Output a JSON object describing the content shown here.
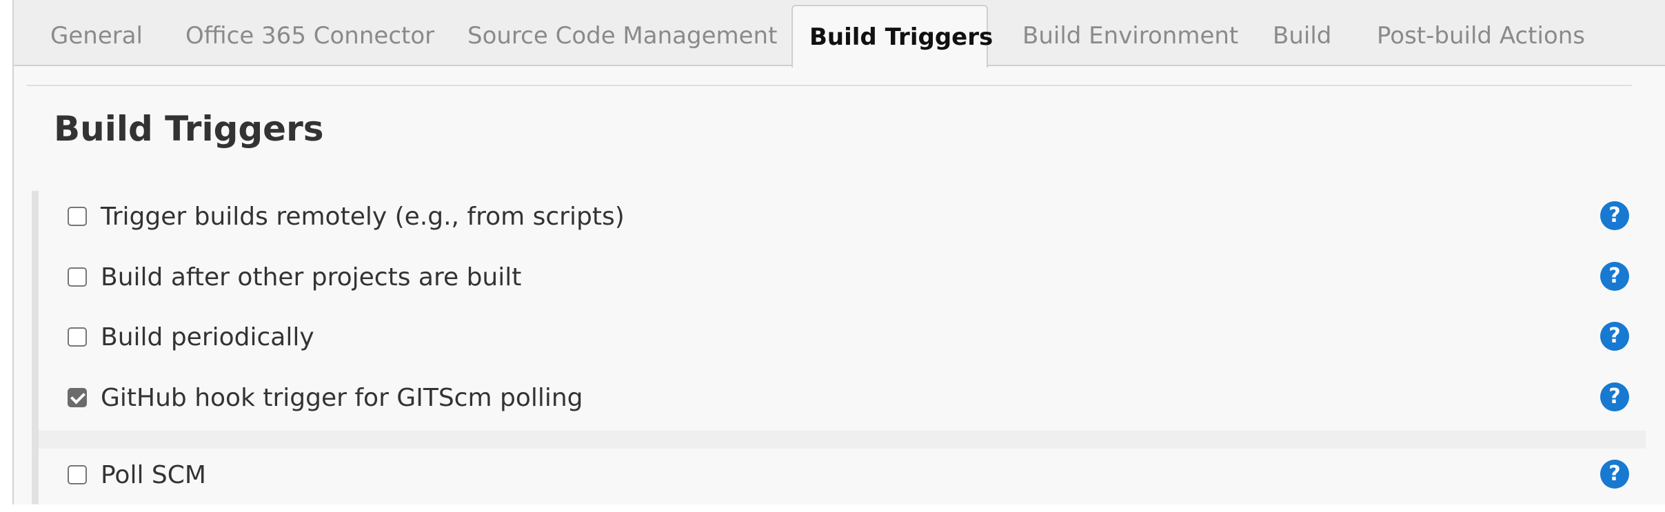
{
  "tabs": [
    {
      "label": "General"
    },
    {
      "label": "Office 365 Connector"
    },
    {
      "label": "Source Code Management"
    },
    {
      "label": "Build Triggers",
      "active": true
    },
    {
      "label": "Build Environment"
    },
    {
      "label": "Build"
    },
    {
      "label": "Post-build Actions"
    }
  ],
  "section": {
    "title": "Build Triggers"
  },
  "triggers": [
    {
      "label": "Trigger builds remotely (e.g., from scripts)",
      "checked": false
    },
    {
      "label": "Build after other projects are built",
      "checked": false
    },
    {
      "label": "Build periodically",
      "checked": false
    },
    {
      "label": "GitHub hook trigger for GITScm polling",
      "checked": true
    },
    {
      "label": "Poll SCM",
      "checked": false
    }
  ],
  "help_icon": {
    "name": "help-icon",
    "glyph": "?"
  },
  "colors": {
    "accent": "#1779d1",
    "active_tab_text": "#111111",
    "inactive_tab_text": "#8a8a8a",
    "panel_bg": "#f8f8f8"
  }
}
